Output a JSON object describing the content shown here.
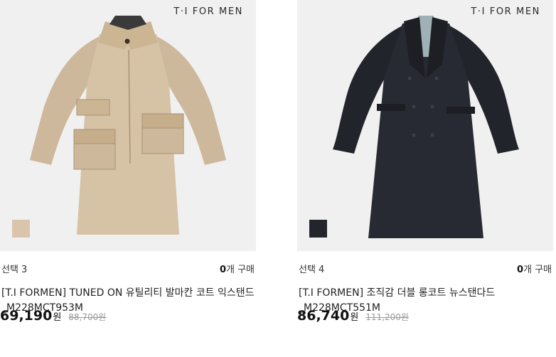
{
  "products": [
    {
      "brand": "T·I FOR MEN",
      "swatch_color": "#d9c4ac",
      "option_label": "선택 3",
      "count_number": "0",
      "count_suffix": "개 구매",
      "title": "[T.I FORMEN] TUNED ON 유틸리티 발마칸 코트 익스탠드_M228MCT953M",
      "price": "69,190",
      "currency": "원",
      "original_price": "88,700원"
    },
    {
      "brand": "T·I FOR MEN",
      "swatch_color": "#23252d",
      "option_label": "선택 4",
      "count_number": "0",
      "count_suffix": "개 구매",
      "title": "[T.I FORMEN] 조직감 더블 롱코트 뉴스탠다드_M228MCT551M",
      "price": "86,740",
      "currency": "원",
      "original_price": "111,200원"
    }
  ]
}
